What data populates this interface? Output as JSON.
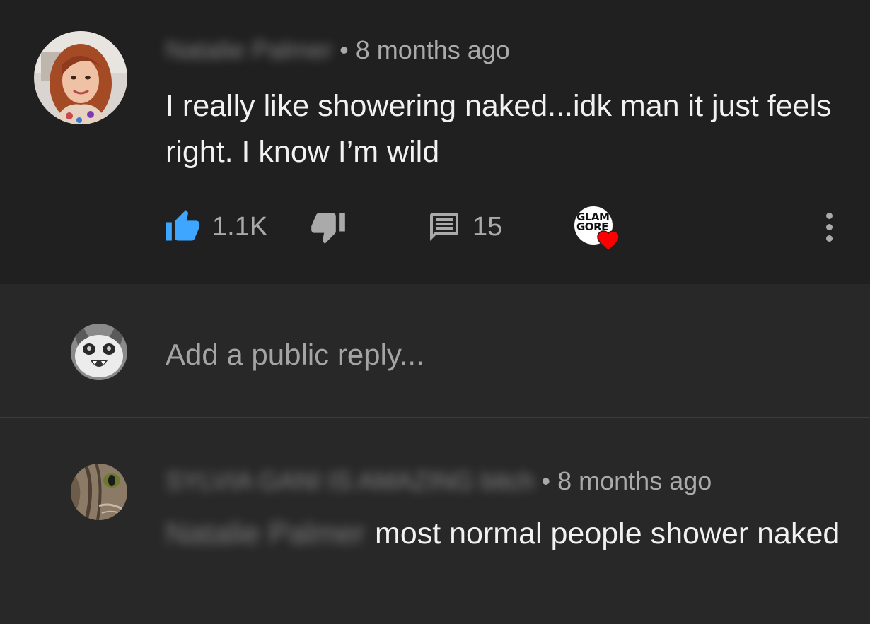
{
  "comment": {
    "author": "Natalie Palmer",
    "time": "8 months ago",
    "bullet": "•",
    "text": "I really like showering naked...idk man it just feels right. I know I’m wild",
    "likes": "1.1K",
    "replies": "15",
    "creator_heart_logo_text": "GLAM GORE",
    "like_color": "#3ea6ff",
    "heart_color": "#ff0000"
  },
  "reply_box": {
    "placeholder": "Add a public reply..."
  },
  "reply": {
    "author": "SYLVIA GANI IS AMAZING bitch",
    "time": "8 months ago",
    "bullet": "•",
    "mention": "Natalie Palmer",
    "text": "most normal people shower naked"
  },
  "icons": [
    "like-icon",
    "dislike-icon",
    "reply-icon",
    "heart-icon",
    "more-vert-icon"
  ]
}
